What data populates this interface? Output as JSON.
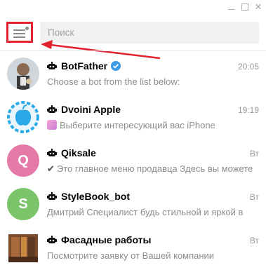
{
  "search": {
    "placeholder": "Поиск"
  },
  "chats": [
    {
      "title": "BotFather",
      "time": "20:05",
      "preview": "Choose a bot from the list below:",
      "verified": true
    },
    {
      "title": "Dvoini Apple",
      "time": "19:19",
      "preview": "Выберите интересующий вас iPhone"
    },
    {
      "title": "Qiksale",
      "time": "Вт",
      "preview": "Это главное меню продавца  Здесь вы можете",
      "avatar_letter": "Q",
      "avatar_color": "#e57aa9"
    },
    {
      "title": "StyleBook_bot",
      "time": "Вт",
      "preview": "Дмитрий Специалист будь стильной и яркой в",
      "avatar_letter": "S",
      "avatar_color": "#7cc46a"
    },
    {
      "title": "Фасадные работы",
      "time": "Вт",
      "preview": "Посмотрите заявку от Вашей компании"
    }
  ],
  "colors": {
    "highlight": "#e2232d",
    "verified": "#3a9be8",
    "muted_text": "#8c8c8c"
  },
  "icons": [
    "menu-icon",
    "bot-icon",
    "verified-icon",
    "minimize-icon",
    "maximize-icon",
    "close-icon"
  ]
}
